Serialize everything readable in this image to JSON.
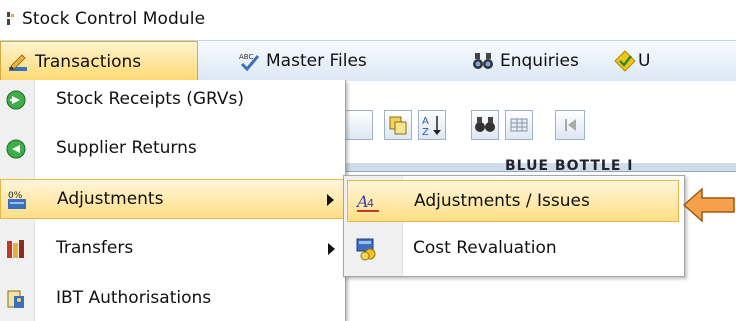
{
  "window": {
    "title": "Stock Control Module"
  },
  "menubar": {
    "items": [
      {
        "label": "Transactions",
        "icon": "ruler-pencil-icon",
        "active": true
      },
      {
        "label": "Master Files",
        "icon": "spellcheck-icon"
      },
      {
        "label": "Enquiries",
        "icon": "binoculars-icon"
      },
      {
        "label": "U",
        "icon": "diamond-check-icon"
      }
    ]
  },
  "background": {
    "header_text": "BLUE BOTTLE I"
  },
  "transactions_menu": {
    "items": [
      {
        "label": "Stock Receipts (GRVs)",
        "icon": "receipt-in-icon",
        "submenu": false
      },
      {
        "label": "Supplier Returns",
        "icon": "return-icon",
        "submenu": false
      },
      {
        "label": "Adjustments",
        "icon": "percent-adjust-icon",
        "submenu": true,
        "highlighted": true
      },
      {
        "label": "Transfers",
        "icon": "transfer-books-icon",
        "submenu": true
      },
      {
        "label": "IBT Authorisations",
        "icon": "authorisation-icon",
        "submenu": false
      }
    ]
  },
  "adjustments_submenu": {
    "items": [
      {
        "label": "Adjustments / Issues",
        "icon": "adjust-a-icon",
        "highlighted": true
      },
      {
        "label": "Cost Revaluation",
        "icon": "revaluation-icon"
      }
    ]
  },
  "colors": {
    "highlight": "#ffde86",
    "highlight_border": "#e7b54a",
    "arrow": "#f5a04b",
    "menubar": "#dbe8f6"
  }
}
